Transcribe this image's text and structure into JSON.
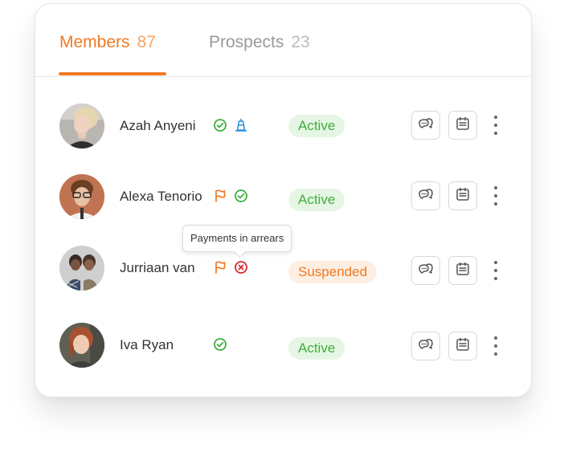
{
  "tabs": {
    "members": {
      "label": "Members",
      "count": "87"
    },
    "prospects": {
      "label": "Prospects",
      "count": "23"
    }
  },
  "members": [
    {
      "name": "Azah Anyeni",
      "status": "Active",
      "icons": [
        "check-circle-icon",
        "pyramid-icon"
      ]
    },
    {
      "name": "Alexa Tenorio",
      "status": "Active",
      "icons": [
        "flag-icon",
        "check-circle-icon"
      ]
    },
    {
      "name": "Jurriaan van",
      "status": "Suspended",
      "icons": [
        "flag-icon",
        "x-circle-icon"
      ]
    },
    {
      "name": "Iva Ryan",
      "status": "Active",
      "icons": [
        "check-circle-icon"
      ]
    }
  ],
  "tooltip": {
    "text": "Payments in arrears"
  },
  "colors": {
    "accent": "#f07a22",
    "active_text": "#3fae3c",
    "active_bg": "#e6f6e4",
    "suspended_text": "#f07a22",
    "suspended_bg": "#fdeee2",
    "danger": "#d9262b",
    "info": "#2d8fdc"
  }
}
